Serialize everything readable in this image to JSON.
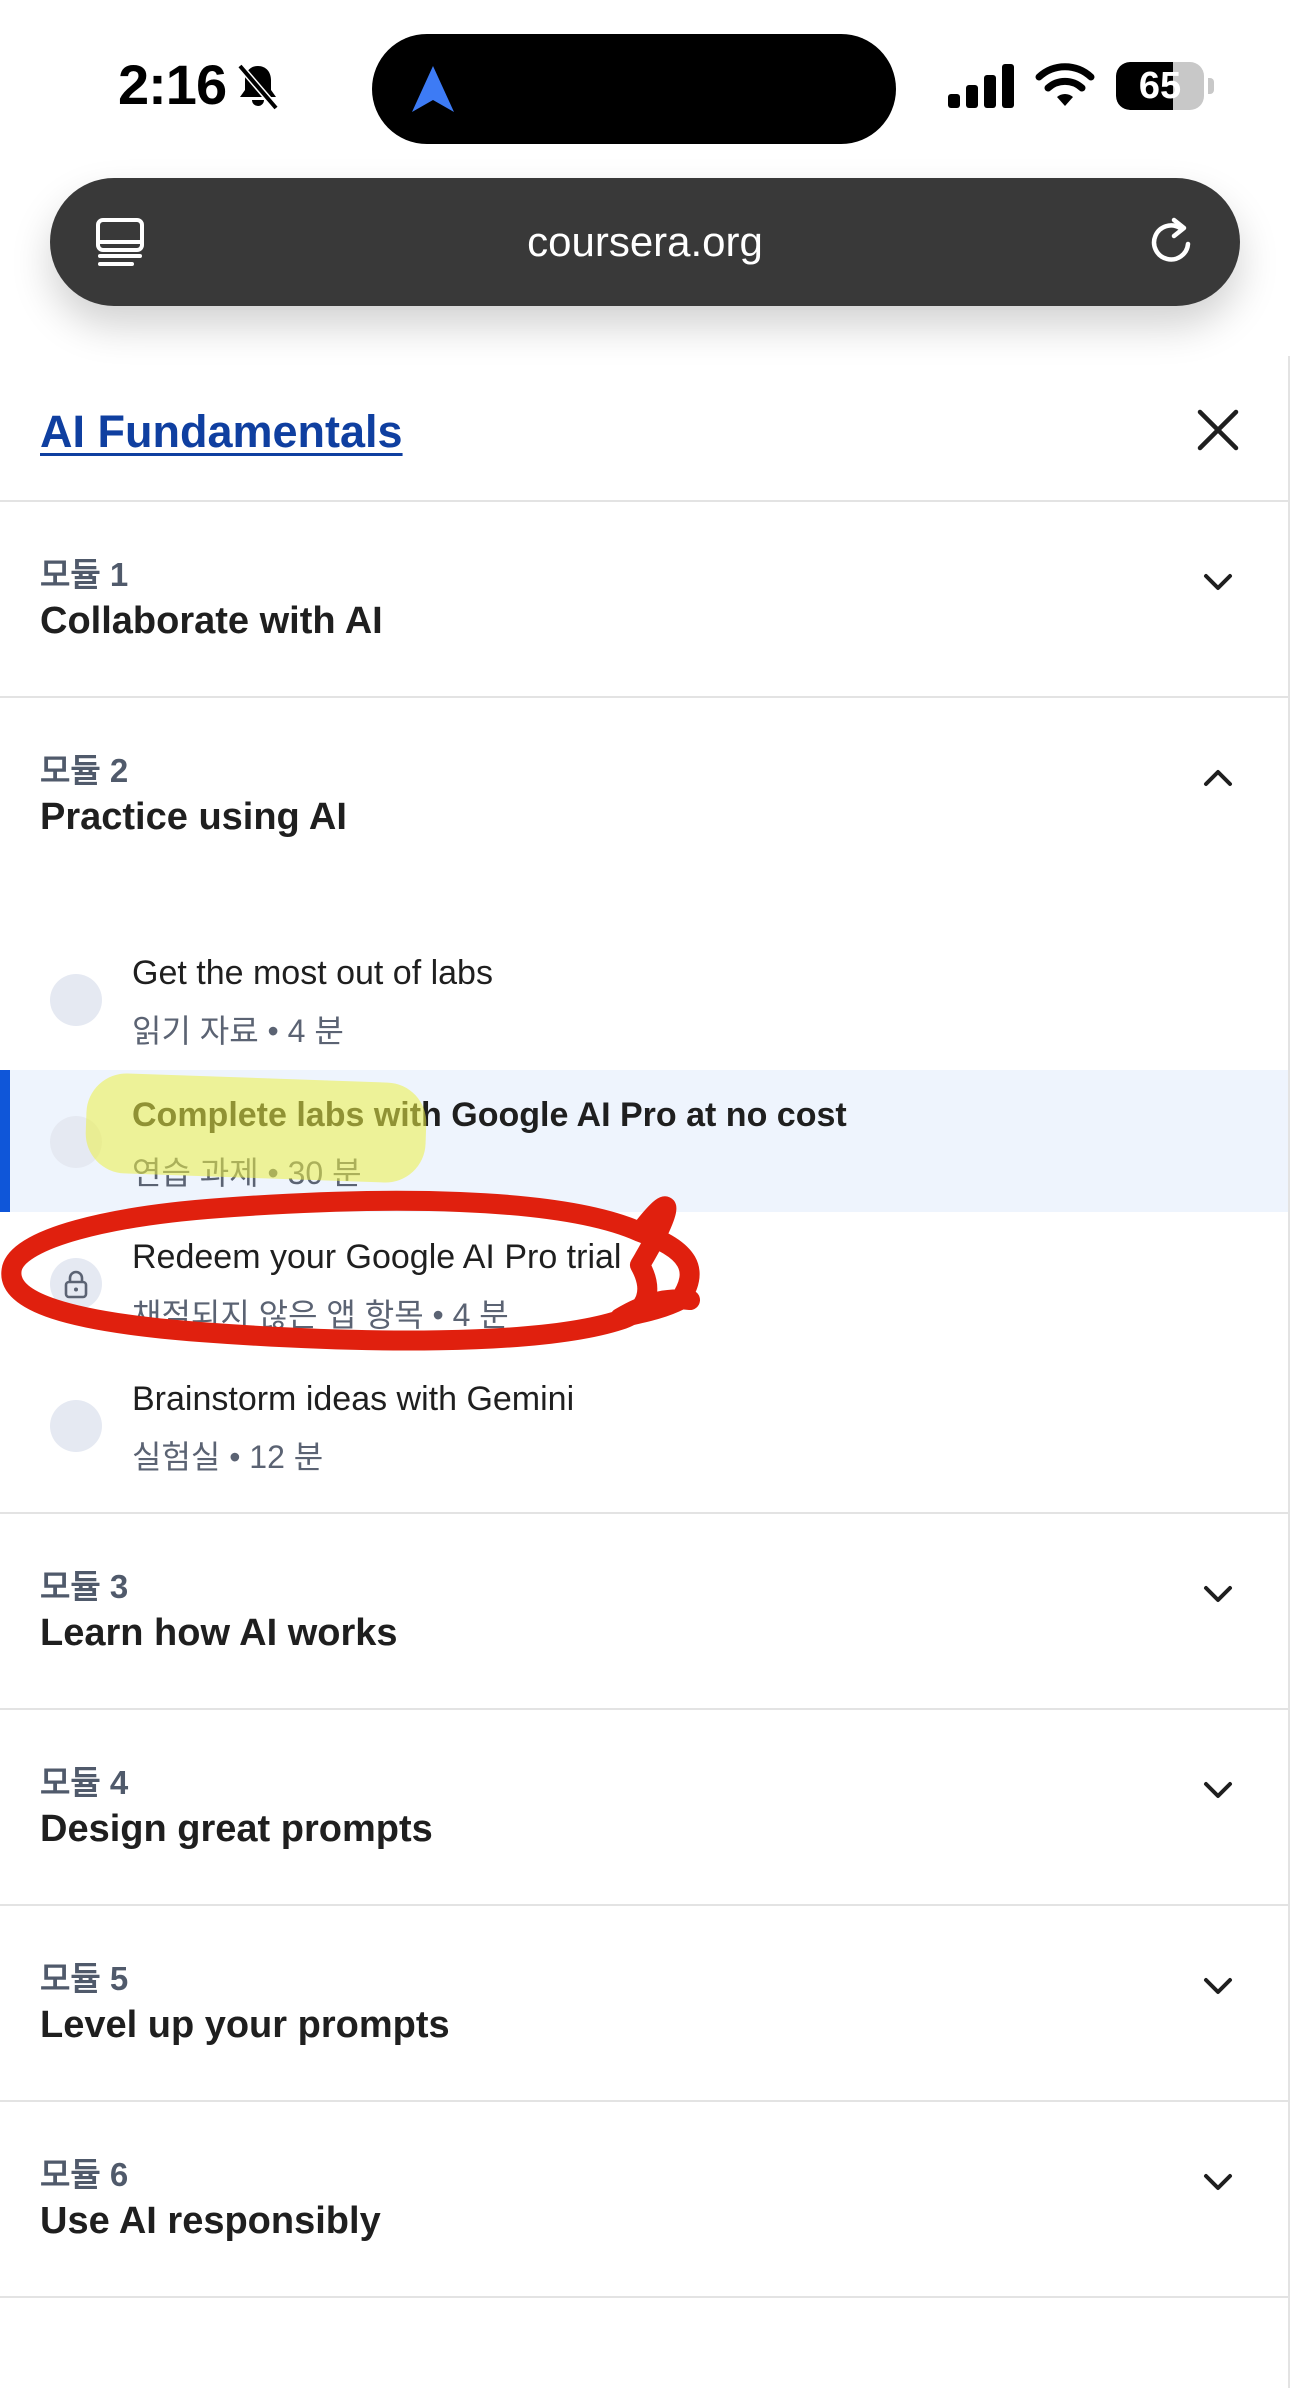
{
  "status_bar": {
    "time": "2:16",
    "battery_percent": 65,
    "battery_label": "65",
    "icons": [
      "bell-slash-icon",
      "navigation-arrow-icon",
      "cellular-signal-icon",
      "wifi-icon",
      "battery-icon"
    ]
  },
  "browser": {
    "url": "coursera.org",
    "icons": [
      "tabs-icon",
      "reload-icon"
    ]
  },
  "course": {
    "title": "AI Fundamentals"
  },
  "modules": [
    {
      "label": "모듈 1",
      "title": "Collaborate with AI",
      "expanded": false
    },
    {
      "label": "모듈 2",
      "title": "Practice using AI",
      "expanded": true,
      "items": [
        {
          "title": "Get the most out of labs",
          "meta": "읽기 자료 • 4 분",
          "status": "incomplete"
        },
        {
          "title": "Complete labs with Google AI Pro at no cost",
          "meta": "연습 과제 • 30 분",
          "status": "current"
        },
        {
          "title": "Redeem your Google AI Pro trial",
          "meta": "채점되지 않은 앱 항목 • 4 분",
          "status": "locked"
        },
        {
          "title": "Brainstorm ideas with Gemini",
          "meta": "실험실 • 12 분",
          "status": "incomplete"
        }
      ]
    },
    {
      "label": "모듈 3",
      "title": "Learn how AI works",
      "expanded": false
    },
    {
      "label": "모듈 4",
      "title": "Design great prompts",
      "expanded": false
    },
    {
      "label": "모듈 5",
      "title": "Level up your prompts",
      "expanded": false
    },
    {
      "label": "모듈 6",
      "title": "Use AI responsibly",
      "expanded": false
    }
  ],
  "colors": {
    "link": "#0f3fa0",
    "active_bar": "#0f56d9",
    "active_bg": "#eef4fd",
    "annotation_red": "#e0200e",
    "highlighter": "#ecf146"
  }
}
